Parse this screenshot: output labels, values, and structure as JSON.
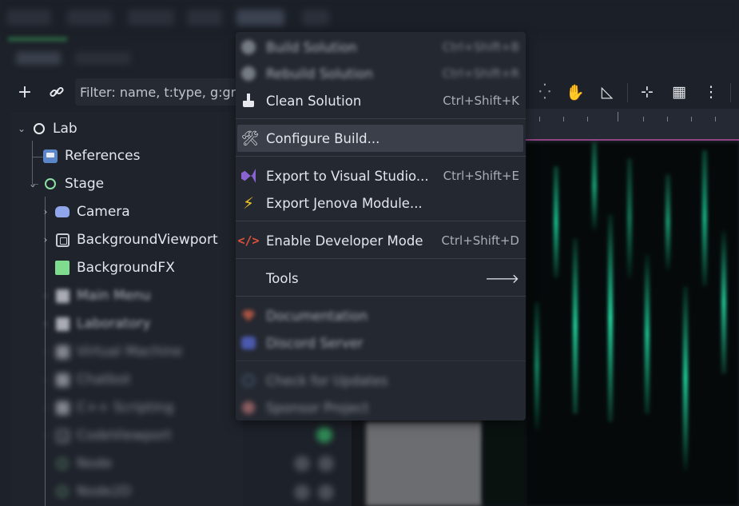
{
  "menu": {
    "items": [
      {
        "label": "Build Solution",
        "shortcut": "Ctrl+Shift+B",
        "icon": "build-icon"
      },
      {
        "label": "Rebuild Solution",
        "shortcut": "Ctrl+Shift+R",
        "icon": "rebuild-icon"
      },
      {
        "label": "Clean Solution",
        "shortcut": "Ctrl+Shift+K",
        "icon": "broom-icon"
      },
      {
        "label": "Configure Build...",
        "shortcut": "",
        "icon": "tools-icon"
      },
      {
        "label": "Export to Visual Studio...",
        "shortcut": "Ctrl+Shift+E",
        "icon": "visual-studio-icon"
      },
      {
        "label": "Export Jenova Module...",
        "shortcut": "",
        "icon": "lightning-icon"
      },
      {
        "label": "Enable Developer Mode",
        "shortcut": "Ctrl+Shift+D",
        "icon": "code-icon"
      },
      {
        "label": "Tools",
        "shortcut": "",
        "icon": "submenu-arrow-icon"
      },
      {
        "label": "Documentation",
        "shortcut": "",
        "icon": "ruby-gem-icon"
      },
      {
        "label": "Discord Server",
        "shortcut": "",
        "icon": "discord-icon"
      },
      {
        "label": "Check for Updates",
        "shortcut": "",
        "icon": "sync-icon"
      },
      {
        "label": "Sponsor Project",
        "shortcut": "",
        "icon": "heart-icon"
      }
    ],
    "submenu_arrow": "🡒"
  },
  "scene": {
    "filter_placeholder": "Filter: name, t:type, g:gro",
    "add_glyph": "+",
    "tree": [
      {
        "label": "Lab"
      },
      {
        "label": "References"
      },
      {
        "label": "Stage"
      },
      {
        "label": "Camera"
      },
      {
        "label": "BackgroundViewport"
      },
      {
        "label": "BackgroundFX"
      },
      {
        "label": "Main Menu"
      },
      {
        "label": "Laboratory"
      },
      {
        "label": "Virtual Machine"
      },
      {
        "label": "Chatbot"
      },
      {
        "label": "C++ Scripting"
      },
      {
        "label": "CodeViewport"
      },
      {
        "label": "Node"
      },
      {
        "label": "Node2D"
      }
    ]
  },
  "colors": {
    "menu_bg": "#242830",
    "highlight": "#3a3f49",
    "matrix_green": "#1fd39a",
    "viewport_border": "#9b4a8f"
  }
}
